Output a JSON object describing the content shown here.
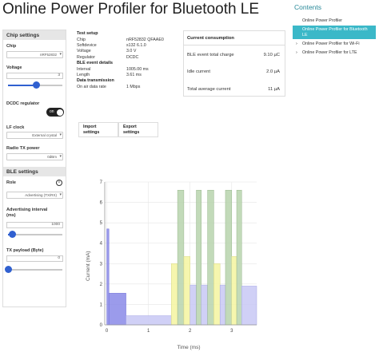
{
  "page": {
    "title": "Online Power Profiler for Bluetooth LE"
  },
  "sidebar": {
    "chip_settings": {
      "header": "Chip settings",
      "chip_label": "Chip",
      "chip_value": "nRF52832",
      "voltage_label": "Voltage",
      "voltage_value": "3",
      "voltage_level": 0.52,
      "dcdc_label": "DCDC regulator",
      "dcdc_toggle": "on",
      "lf_clock_label": "LF clock",
      "lf_clock_value": "External crystal",
      "tx_power_label": "Radio TX power",
      "tx_power_value": "0dBm"
    },
    "ble_settings": {
      "header": "BLE settings",
      "role_label": "Role",
      "role_info": "i",
      "role_value": "Advertising (TX/RX)",
      "adv_interval_label_line1": "Advertising interval",
      "adv_interval_label_line2": "(ms)",
      "adv_interval_value": "1000",
      "adv_interval_level": 0.08,
      "tx_payload_label": "TX payload (Byte)",
      "tx_payload_value": "0",
      "tx_payload_level": 0.0
    }
  },
  "test_setup": {
    "header": "Test setup",
    "rows": [
      {
        "key": "Chip",
        "value": "nRF52832 QFAAE0"
      },
      {
        "key": "Softdevice",
        "value": "s132 6.1.0"
      },
      {
        "key": "Voltage",
        "value": "3.0 V"
      },
      {
        "key": "Regulator",
        "value": "DCDC"
      }
    ],
    "ble_header": "BLE event details",
    "ble_rows": [
      {
        "key": "Interval",
        "value": "1005.00 ms"
      },
      {
        "key": "Length",
        "value": "3.61 ms"
      }
    ],
    "data_header": "Data transmission",
    "data_rows": [
      {
        "key": "On air data rate",
        "value": "1 Mbps"
      }
    ]
  },
  "consumption": {
    "title": "Current consumption",
    "rows": [
      {
        "key": "BLE event total charge",
        "value": "9.10 µC"
      },
      {
        "key": "Idle current",
        "value": "2.0 µA"
      },
      {
        "key": "Total average current",
        "value": "11 µA"
      }
    ]
  },
  "actions": {
    "import_line1": "Import",
    "import_line2": "settings",
    "export_line1": "Export",
    "export_line2": "settings"
  },
  "contents": {
    "title": "Contents",
    "items": [
      {
        "label": "Online Power Profiler"
      },
      {
        "label_line1": "Online Power Profiler for Bluetooth",
        "label_line2": "LE",
        "active": true
      },
      {
        "label": "Online Power Profiler for Wi-Fi",
        "expandable": true
      },
      {
        "label": "Online Power Profiler for LTE",
        "expandable": true
      }
    ]
  },
  "colors": {
    "accent": "#3bb8c8",
    "slider": "#3060d0",
    "purple": "#8a8ae8",
    "purple_light": "#c8c8f4",
    "green": "#b7d3ad",
    "yellow": "#f5f5a0"
  },
  "chart_data": {
    "type": "bar",
    "xlabel": "Time (ms)",
    "ylabel": "Current (mA)",
    "xlim": [
      -0.05,
      3.6
    ],
    "ylim": [
      0,
      7
    ],
    "x_ticks": [
      0,
      1,
      2,
      3
    ],
    "y_ticks": [
      0,
      1,
      2,
      3,
      4,
      5,
      6,
      7
    ],
    "segments": [
      {
        "x0": 0.0,
        "x1": 0.05,
        "y": 4.7,
        "color": "purple"
      },
      {
        "x0": 0.05,
        "x1": 0.46,
        "y": 1.55,
        "color": "purple"
      },
      {
        "x0": 0.46,
        "x1": 1.55,
        "y": 0.45,
        "color": "purple_light"
      },
      {
        "x0": 1.55,
        "x1": 1.7,
        "y": 3.0,
        "color": "yellow"
      },
      {
        "x0": 1.7,
        "x1": 1.85,
        "y": 6.6,
        "color": "green"
      },
      {
        "x0": 1.85,
        "x1": 2.0,
        "y": 3.35,
        "color": "yellow"
      },
      {
        "x0": 2.0,
        "x1": 2.15,
        "y": 1.95,
        "color": "purple_light"
      },
      {
        "x0": 2.15,
        "x1": 2.27,
        "y": 6.6,
        "color": "green"
      },
      {
        "x0": 2.27,
        "x1": 2.42,
        "y": 1.95,
        "color": "purple_light"
      },
      {
        "x0": 2.42,
        "x1": 2.57,
        "y": 6.6,
        "color": "green"
      },
      {
        "x0": 2.57,
        "x1": 2.72,
        "y": 3.0,
        "color": "yellow"
      },
      {
        "x0": 2.72,
        "x1": 2.85,
        "y": 1.95,
        "color": "purple_light"
      },
      {
        "x0": 2.85,
        "x1": 3.0,
        "y": 6.6,
        "color": "green"
      },
      {
        "x0": 3.0,
        "x1": 3.12,
        "y": 3.35,
        "color": "yellow"
      },
      {
        "x0": 3.12,
        "x1": 3.24,
        "y": 6.6,
        "color": "green"
      },
      {
        "x0": 3.24,
        "x1": 3.6,
        "y": 1.9,
        "color": "purple_light"
      }
    ]
  }
}
